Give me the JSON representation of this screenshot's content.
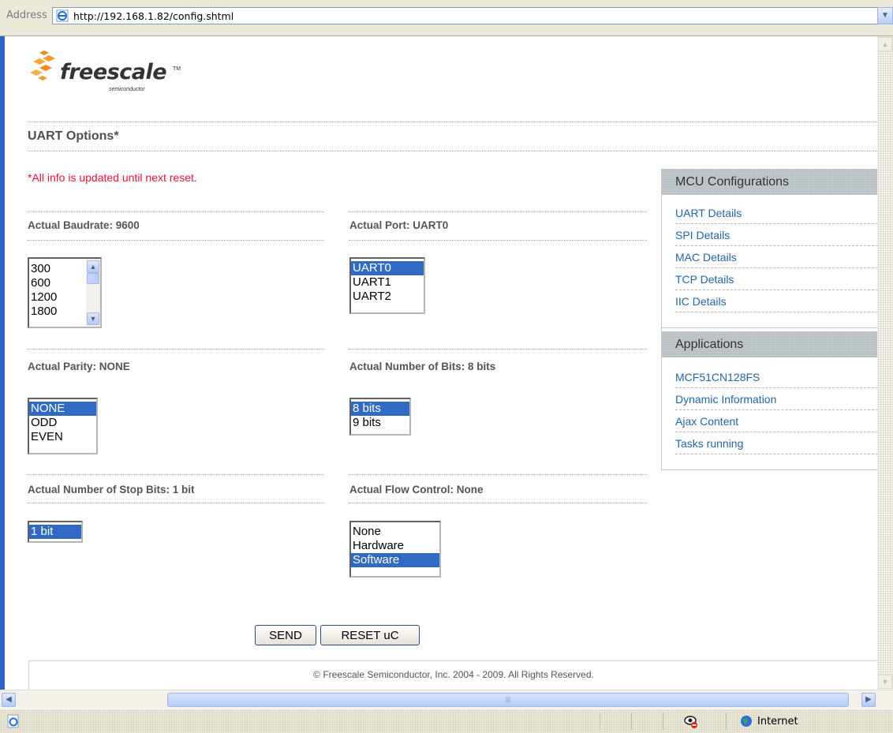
{
  "browser": {
    "address_label": "Address",
    "url": "http://192.168.1.82/config.shtml",
    "status_zone": "Internet"
  },
  "logo": {
    "name": "freescale",
    "tm": "TM",
    "sub": "semiconductor"
  },
  "page": {
    "heading": "UART Options*",
    "note": "*All info is updated until next reset."
  },
  "fields": {
    "baudrate": {
      "label": "Actual Baudrate: 9600",
      "options": [
        "300",
        "600",
        "1200",
        "1800"
      ]
    },
    "port": {
      "label": "Actual Port: UART0",
      "options": [
        "UART0",
        "UART1",
        "UART2"
      ],
      "selected": "UART0"
    },
    "parity": {
      "label": "Actual Parity: NONE",
      "options": [
        "NONE",
        "ODD",
        "EVEN"
      ],
      "selected": "NONE"
    },
    "bits": {
      "label": "Actual Number of Bits: 8 bits",
      "options": [
        "8 bits",
        "9 bits"
      ],
      "selected": "8 bits"
    },
    "stop_bits": {
      "label": "Actual Number of Stop Bits: 1 bit",
      "options": [
        "1 bit"
      ],
      "selected": "1 bit"
    },
    "flow": {
      "label": "Actual Flow Control: None",
      "options": [
        "None",
        "Hardware",
        "Software"
      ],
      "selected": "Software"
    }
  },
  "buttons": {
    "send": "SEND",
    "reset": "RESET uC"
  },
  "sidebar": {
    "mcu_title": "MCU Configurations",
    "mcu_links": [
      "UART Details",
      "SPI Details",
      "MAC Details",
      "TCP Details",
      "IIC Details"
    ],
    "apps_title": "Applications",
    "apps_links": [
      "MCF51CN128FS",
      "Dynamic Information",
      "Ajax Content",
      "Tasks running"
    ]
  },
  "footer": "© Freescale Semiconductor, Inc. 2004 - 2009. All Rights Reserved.",
  "colors": {
    "selection": "#316ac5",
    "link": "#2266aa",
    "note": "#ee1133",
    "frame": "#2f64c6"
  }
}
